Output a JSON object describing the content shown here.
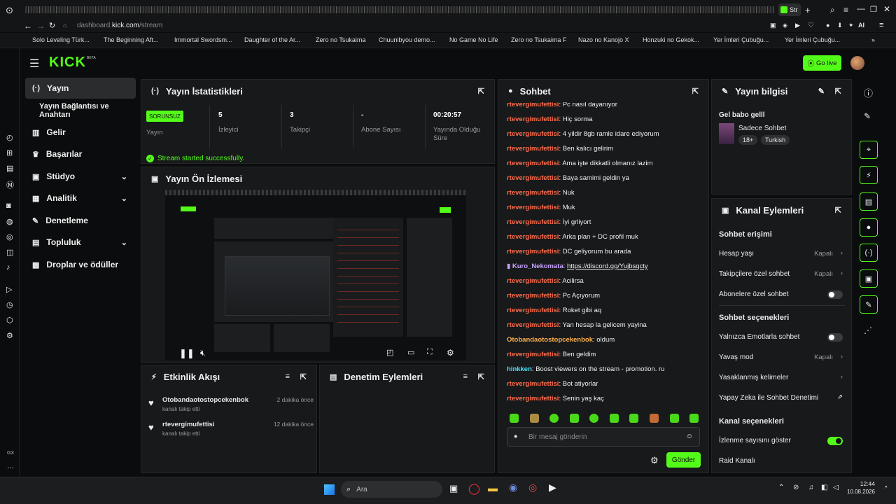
{
  "browser": {
    "tab_title": "Str",
    "url_prefix": "dashboard.",
    "url_domain": "kick.com",
    "url_path": "/stream",
    "ai_label": "AI",
    "bookmarks": [
      "Solo Leveling Türk...",
      "The Beginning Aft...",
      "Immortal Swordsm...",
      "Daughter of the Ar...",
      "Zero no Tsukaima",
      "Chuunibyou demo...",
      "No Game No Life",
      "Zero no Tsukaima F",
      "Nazo no Kanojo X",
      "Honzuki no Gekok...",
      "Yer İmleri Çubuğu...",
      "Yer İmleri Çubuğu..."
    ]
  },
  "brand": {
    "logo": "KICK",
    "beta": "BETA",
    "go_live": "Go live"
  },
  "sidebar": {
    "items": [
      {
        "label": "Yayın",
        "icon": "broadcast-icon"
      },
      {
        "label": "Yayın Bağlantısı ve Anahtarı",
        "icon": ""
      },
      {
        "label": "Gelir",
        "icon": "chart-icon"
      },
      {
        "label": "Başarılar",
        "icon": "trophy-icon"
      },
      {
        "label": "Stüdyo",
        "icon": "studio-icon"
      },
      {
        "label": "Analitik",
        "icon": "analytics-icon"
      },
      {
        "label": "Denetleme",
        "icon": "wrench-icon"
      },
      {
        "label": "Topluluk",
        "icon": "community-icon"
      },
      {
        "label": "Droplar ve ödüller",
        "icon": "gift-icon"
      }
    ],
    "left_strip_label": "GX"
  },
  "stats": {
    "title": "Yayın İstatistikleri",
    "badge": "SORUNSUZ",
    "badge_label": "Yayın",
    "viewers_value": "5",
    "viewers_label": "İzleyici",
    "followers_value": "3",
    "followers_label": "Takipçi",
    "subs_value": "-",
    "subs_label": "Abone Sayısı",
    "uptime_value": "00:20:57",
    "uptime_label": "Yayında Olduğu Süre",
    "success": "Stream started successfully."
  },
  "preview": {
    "title": "Yayın Ön İzlemesi"
  },
  "activity": {
    "title": "Etkinlik Akışı",
    "events": [
      {
        "user": "Otobandaotostopcekenbok",
        "action": "kanalı takip etti",
        "time": "2 dakika önce"
      },
      {
        "user": "rtevergimufettisi",
        "action": "kanalı takip etti",
        "time": "12 dakika önce"
      }
    ]
  },
  "moderation": {
    "title": "Denetim Eylemleri"
  },
  "chat": {
    "title": "Sohbet",
    "messages": [
      {
        "user": "rtevergimufettisi",
        "text": "Pc nasıl dayanıyor",
        "color": "red"
      },
      {
        "user": "rtevergimufettisi",
        "text": "Hiç sorma",
        "color": "red"
      },
      {
        "user": "rtevergimufettisi",
        "text": "4 yildir 8gb ramle idare ediyorum",
        "color": "red"
      },
      {
        "user": "rtevergimufettisi",
        "text": "Ben kalıcı gelirim",
        "color": "red"
      },
      {
        "user": "rtevergimufettisi",
        "text": "Ama işte dikkatli olmanız lazim",
        "color": "red"
      },
      {
        "user": "rtevergimufettisi",
        "text": "Baya samimi geldin ya",
        "color": "red"
      },
      {
        "user": "rtevergimufettisi",
        "text": "Nuk",
        "color": "red"
      },
      {
        "user": "rtevergimufettisi",
        "text": "Muk",
        "color": "red"
      },
      {
        "user": "rtevergimufettisi",
        "text": "İyi grliyort",
        "color": "red"
      },
      {
        "user": "rtevergimufettisi",
        "text": "Arka plan + DC profil muk",
        "color": "red"
      },
      {
        "user": "rtevergimufettisi",
        "text": "DC geliyorum bu arada",
        "color": "red"
      },
      {
        "user": "Kuro_Nekomata",
        "text": "https://discord.gg/Yujbsqcty",
        "color": "purple"
      },
      {
        "user": "rtevergimufettisi",
        "text": "Acilirsa",
        "color": "red"
      },
      {
        "user": "rtevergimufettisi",
        "text": "Pc Açıyorum",
        "color": "red"
      },
      {
        "user": "rtevergimufettisi",
        "text": "Roket gibi aq",
        "color": "red"
      },
      {
        "user": "rtevergimufettisi",
        "text": "Yan hesap la gelicem yayina",
        "color": "red"
      },
      {
        "user": "Otobandaotostopcekenbok",
        "text": "oldum",
        "color": "orange"
      },
      {
        "user": "rtevergimufettisi",
        "text": "Ben geldim",
        "color": "red"
      },
      {
        "user": "hinkken",
        "text": "Boost viewers on the stream - promotion. ru",
        "color": "cyan"
      },
      {
        "user": "rtevergimufettisi",
        "text": "Bot atiyorlar",
        "color": "red"
      },
      {
        "user": "rtevergimufettisi",
        "text": "Senin yaş kaç",
        "color": "red"
      }
    ],
    "placeholder": "Bir mesaj gönderin",
    "send": "Gönder"
  },
  "stream_info": {
    "title": "Yayın bilgisi",
    "stream_title": "Gel babo gelll",
    "category": "Sadece Sohbet",
    "tags": [
      "18+",
      "Turkish"
    ]
  },
  "channel_actions": {
    "title": "Kanal Eylemleri",
    "chat_access": "Sohbet erişimi",
    "account_age": "Hesap yaşı",
    "account_age_val": "Kapalı",
    "followers_only": "Takipçilere özel sohbet",
    "followers_only_val": "Kapalı",
    "subs_only": "Abonelere özel sohbet",
    "chat_options": "Sohbet seçenekleri",
    "emote_only": "Yalnızca Emotlarla sohbet",
    "slow_mode": "Yavaş mod",
    "slow_mode_val": "Kapalı",
    "banned_words": "Yasaklanmış kelimeler",
    "ai_moderation": "Yapay Zeka ile Sohbet Denetimi",
    "channel_options": "Kanal seçenekleri",
    "show_viewers": "İzlenme sayısını göster",
    "raid": "Raid Kanalı"
  },
  "taskbar": {
    "search": "Ara",
    "time": "12:44",
    "date": "10.08.2026"
  }
}
